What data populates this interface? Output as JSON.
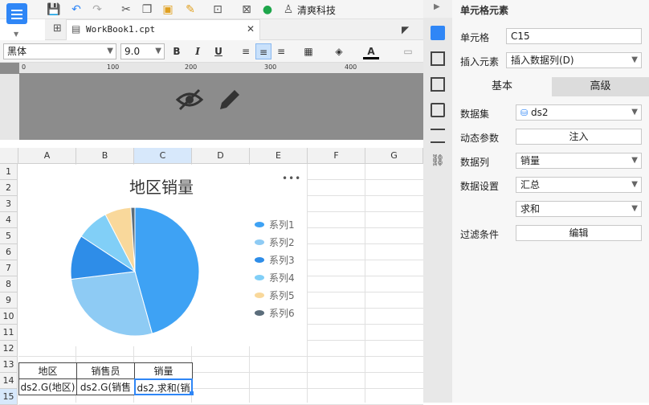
{
  "toolbar": {
    "app_title": "清爽科技"
  },
  "tab": {
    "label": "WorkBook1.cpt"
  },
  "format": {
    "font": "黑体",
    "size": "9.0",
    "bold": "B",
    "italic": "I",
    "underline": "U",
    "font_color_label": "A"
  },
  "ruler": {
    "ticks": [
      "0",
      "100",
      "200",
      "300",
      "400"
    ]
  },
  "columns": [
    "A",
    "B",
    "C",
    "D",
    "E",
    "F",
    "G"
  ],
  "rows": [
    "1",
    "2",
    "3",
    "4",
    "5",
    "6",
    "7",
    "8",
    "9",
    "10",
    "11",
    "12",
    "13",
    "14",
    "15"
  ],
  "table": {
    "headers": [
      "地区",
      "销售员",
      "销量"
    ],
    "row15": [
      "ds2.G(地区)",
      "ds2.G(销售",
      "ds2.求和(销"
    ]
  },
  "chart_data": {
    "type": "pie",
    "title": "地区销量",
    "more_label": "•••",
    "series": [
      {
        "name": "系列1",
        "value": 45,
        "color": "#3ea2f4"
      },
      {
        "name": "系列2",
        "value": 27,
        "color": "#8ecbf4"
      },
      {
        "name": "系列3",
        "value": 11,
        "color": "#2e8de8"
      },
      {
        "name": "系列4",
        "value": 8,
        "color": "#81cff7"
      },
      {
        "name": "系列5",
        "value": 6.5,
        "color": "#f9d89b"
      },
      {
        "name": "系列6",
        "value": 1,
        "color": "#5b6d7b"
      }
    ],
    "legend_position": "right"
  },
  "panel": {
    "title": "单元格元素",
    "cell_label": "单元格",
    "cell_value": "C15",
    "insert_label": "插入元素",
    "insert_value": "插入数据列(D)",
    "tab_basic": "基本",
    "tab_advanced": "高级",
    "dataset_label": "数据集",
    "dataset_value": "ds2",
    "dynamic_label": "动态参数",
    "inject_button": "注入",
    "column_label": "数据列",
    "column_value": "销量",
    "setting_label": "数据设置",
    "setting_value": "汇总",
    "agg_value": "求和",
    "filter_label": "过滤条件",
    "edit_button": "编辑"
  }
}
